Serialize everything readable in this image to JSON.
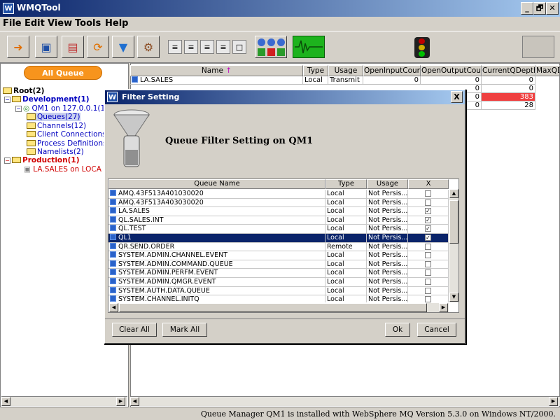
{
  "window": {
    "title": "WMQTool",
    "app_icon": "W"
  },
  "window_controls": {
    "minimize": "_",
    "restore": "🗗",
    "close": "✕"
  },
  "menu": [
    "File",
    "Edit",
    "View",
    "Tools",
    "Help"
  ],
  "toolbar": {
    "icons": [
      "exit-icon",
      "save-icon",
      "properties-icon",
      "refresh-icon",
      "filter-icon",
      "settings-icon"
    ],
    "view_icons": [
      "view-1-icon",
      "view-2-icon",
      "view-3-icon",
      "view-4-icon",
      "view-5-icon"
    ]
  },
  "tree": {
    "all_button": "All Queue Managers",
    "nodes": [
      {
        "label": "Root(2)"
      },
      {
        "label": "Development(1)"
      },
      {
        "label": "QM1 on 127.0.0.1(1"
      },
      {
        "label": "Queues(27)"
      },
      {
        "label": "Channels(12)"
      },
      {
        "label": "Client Connections"
      },
      {
        "label": "Process Definitions"
      },
      {
        "label": "Namelists(2)"
      },
      {
        "label": "Production(1)"
      },
      {
        "label": "LA.SALES on LOCA"
      }
    ]
  },
  "main_table": {
    "columns": [
      "Name",
      "Type",
      "Usage",
      "OpenInputCount",
      "OpenOutputCount",
      "CurrentQDepth",
      "MaxQD"
    ],
    "sort_arrow": "↑",
    "rows": [
      [
        "LA.SALES",
        "Local",
        "Transmit",
        "0",
        "0",
        "0",
        ""
      ],
      [
        "",
        "",
        "",
        "",
        "0",
        "0",
        ""
      ],
      [
        "",
        "",
        "",
        "",
        "0",
        "383",
        ""
      ],
      [
        "",
        "",
        "",
        "",
        "0",
        "28",
        ""
      ]
    ],
    "alert_color": "#ef4040"
  },
  "dialog": {
    "title": "Filter Setting",
    "close": "X",
    "heading": "Queue Filter Setting on QM1",
    "columns": [
      "Queue Name",
      "Type",
      "Usage",
      "X"
    ],
    "rows": [
      {
        "name": "AMQ.43F513A401030020",
        "type": "Local",
        "usage": "Not Persis...",
        "checked": false
      },
      {
        "name": "AMQ.43F513A403030020",
        "type": "Local",
        "usage": "Not Persis...",
        "checked": false
      },
      {
        "name": "LA.SALES",
        "type": "Local",
        "usage": "Not Persis...",
        "checked": true
      },
      {
        "name": "QL.SALES.INT",
        "type": "Local",
        "usage": "Not Persis...",
        "checked": true
      },
      {
        "name": "QL.TEST",
        "type": "Local",
        "usage": "Not Persis...",
        "checked": true
      },
      {
        "name": "QL1",
        "type": "Local",
        "usage": "Not Persis...",
        "checked": true,
        "selected": true
      },
      {
        "name": "QR.SEND.ORDER",
        "type": "Remote",
        "usage": "Not Persis...",
        "checked": false
      },
      {
        "name": "SYSTEM.ADMIN.CHANNEL.EVENT",
        "type": "Local",
        "usage": "Not Persis...",
        "checked": false
      },
      {
        "name": "SYSTEM.ADMIN.COMMAND.QUEUE",
        "type": "Local",
        "usage": "Not Persis...",
        "checked": false
      },
      {
        "name": "SYSTEM.ADMIN.PERFM.EVENT",
        "type": "Local",
        "usage": "Not Persis...",
        "checked": false
      },
      {
        "name": "SYSTEM.ADMIN.QMGR.EVENT",
        "type": "Local",
        "usage": "Not Persis...",
        "checked": false
      },
      {
        "name": "SYSTEM.AUTH.DATA.QUEUE",
        "type": "Local",
        "usage": "Not Persis...",
        "checked": false
      },
      {
        "name": "SYSTEM.CHANNEL.INITQ",
        "type": "Local",
        "usage": "Not Persis...",
        "checked": false
      }
    ],
    "buttons": {
      "clear_all": "Clear All",
      "mark_all": "Mark All",
      "ok": "Ok",
      "cancel": "Cancel"
    }
  },
  "status_bar": "Queue Manager QM1 is installed with WebSphere MQ Version 5.3.0 on Windows NT/2000."
}
